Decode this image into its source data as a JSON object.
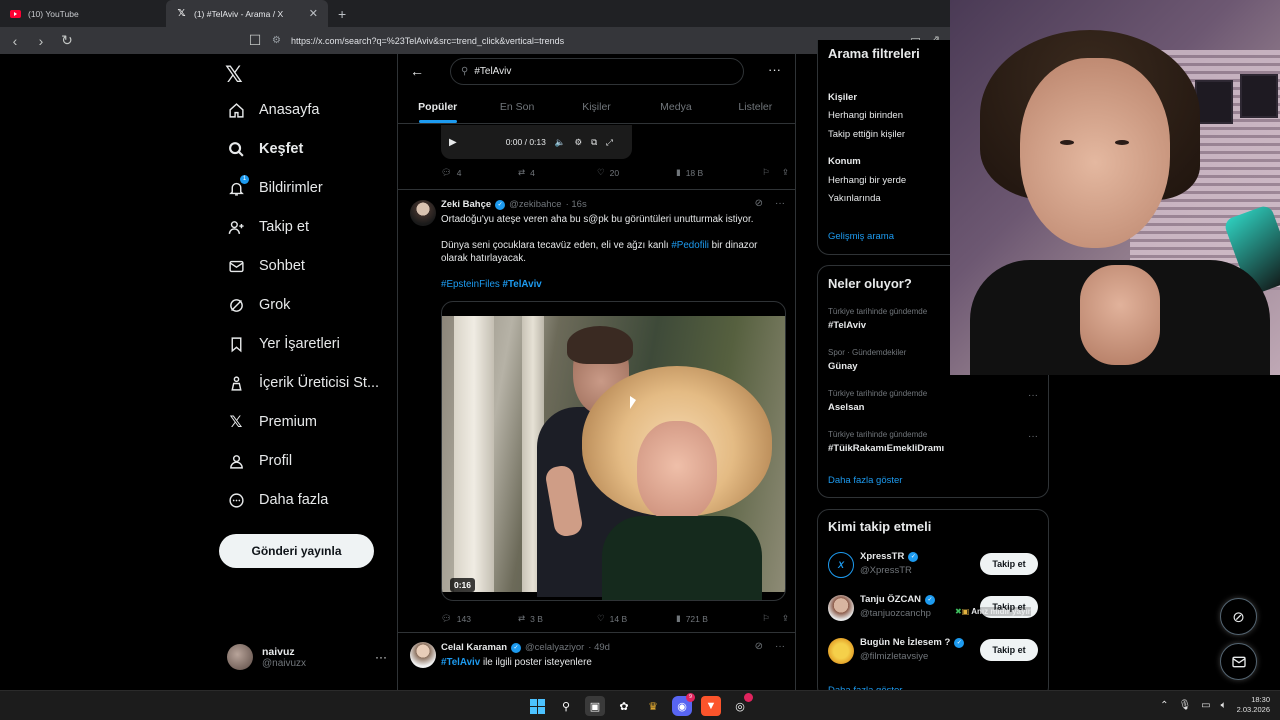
{
  "browser": {
    "tabs": [
      {
        "title": "(10) YouTube",
        "favicon": "youtube-icon"
      },
      {
        "title": "(1) #TelAviv - Arama / X",
        "favicon": "x-icon",
        "active": true
      }
    ],
    "url": "https://x.com/search?q=%23TelAviv&src=trend_click&vertical=trends"
  },
  "nav": {
    "items": [
      {
        "label": "Anasayfa",
        "icon": "home-icon"
      },
      {
        "label": "Keşfet",
        "icon": "search-icon",
        "active": true
      },
      {
        "label": "Bildirimler",
        "icon": "bell-icon",
        "badge": "1"
      },
      {
        "label": "Takip et",
        "icon": "person-plus-icon"
      },
      {
        "label": "Sohbet",
        "icon": "mail-icon"
      },
      {
        "label": "Grok",
        "icon": "grok-icon"
      },
      {
        "label": "Yer İşaretleri",
        "icon": "bookmark-icon"
      },
      {
        "label": "İçerik Üreticisi St...",
        "icon": "creator-icon"
      },
      {
        "label": "Premium",
        "icon": "x-premium-icon"
      },
      {
        "label": "Profil",
        "icon": "profile-icon"
      },
      {
        "label": "Daha fazla",
        "icon": "more-circle-icon"
      }
    ],
    "post_button": "Gönderi yayınla",
    "account": {
      "name": "naivuz",
      "handle": "@naivuzx"
    }
  },
  "search": {
    "query": "#TelAviv",
    "tabs": [
      "Popüler",
      "En Son",
      "Kişiler",
      "Medya",
      "Listeler"
    ]
  },
  "video_stub": {
    "time": "0:00 / 0:13"
  },
  "post0_actions": {
    "replies": "4",
    "reposts": "4",
    "likes": "20",
    "views": "18 B"
  },
  "post1": {
    "name": "Zeki Bahçe",
    "handle": "@zekibahce",
    "time": "· 16s",
    "line1": "Ortadoğu'yu ateşe veren aha bu s@pk bu görüntüleri unutturmak istiyor.",
    "line2a": "Dünya seni çocuklara tecavüz eden, eli ve ağzı kanlı ",
    "line2tag": "#Pedofili",
    "line2b": " bir dinazor",
    "line3": "olarak hatırlayacak.",
    "tag1": "#EpsteinFiles",
    "tag2": "#TelAviv",
    "video_duration": "0:16",
    "replies": "143",
    "reposts": "3 B",
    "likes": "14 B",
    "views": "721 B"
  },
  "post2": {
    "name": "Celal Karaman",
    "handle": "@celalyaziyor",
    "time": "· 49d",
    "tag": "#TelAviv",
    "text": " ile ilgili poster isteyenlere"
  },
  "filters": {
    "title": "Arama filtreleri",
    "people_label": "Kişiler",
    "people_opt1": "Herhangi birinden",
    "people_opt2": "Takip ettiğin kişiler",
    "location_label": "Konum",
    "location_opt1": "Herhangi bir yerde",
    "location_opt2": "Yakınlarında",
    "advanced": "Gelişmiş arama"
  },
  "trends": {
    "title": "Neler oluyor?",
    "items": [
      {
        "context": "Türkiye tarihinde gündemde",
        "name": "#TelAviv"
      },
      {
        "context": "Spor · Gündemdekiler",
        "name": "Günay"
      },
      {
        "context": "Türkiye tarihinde gündemde",
        "name": "Aselsan"
      },
      {
        "context": "Türkiye tarihinde gündemde",
        "name": "#TüikRakamıEmekliDramı"
      }
    ],
    "show_more": "Daha fazla göster"
  },
  "who_to_follow": {
    "title": "Kimi takip etmeli",
    "items": [
      {
        "name": "XpressTR",
        "handle": "@XpressTR",
        "button": "Takip et"
      },
      {
        "name": "Tanju ÖZCAN",
        "handle": "@tanjuozcanchp",
        "button": "Takip et"
      },
      {
        "name": "Bugün Ne İzlesem ?",
        "handle": "@filmizletavsiye",
        "button": "Takip et"
      }
    ],
    "show_more": "Daha fazla göster",
    "overlay_text": "Anız mıdır yayır"
  },
  "taskbar": {
    "time": "18:30",
    "date": "2.03.2026"
  },
  "colors": {
    "accent": "#1d9bf0",
    "background": "#000000",
    "border": "#2f3336",
    "muted": "#71767b"
  }
}
